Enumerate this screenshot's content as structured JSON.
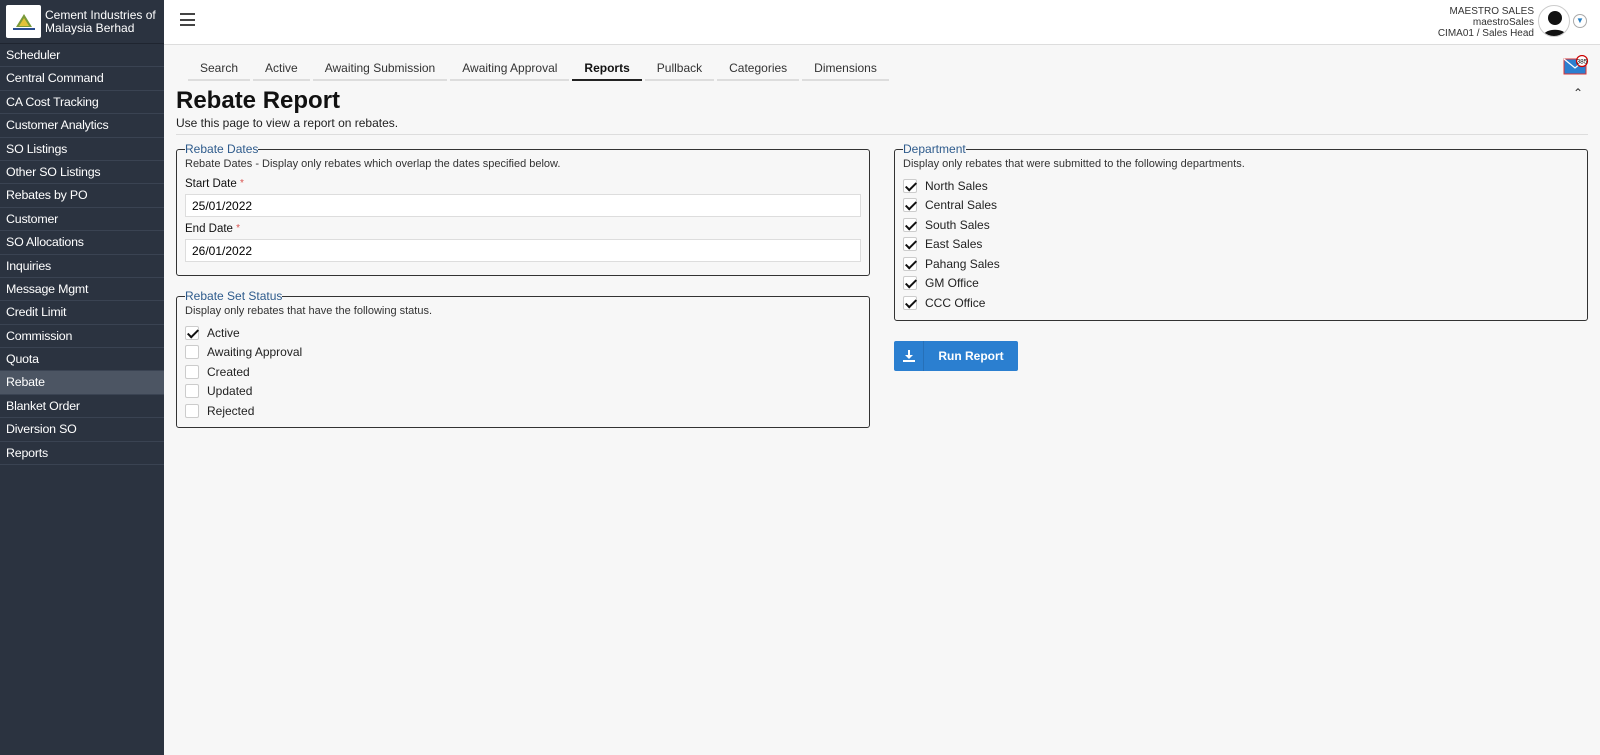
{
  "brand": {
    "name": "Cement Industries of Malaysia Berhad"
  },
  "sidebar": {
    "items": [
      {
        "label": "Scheduler"
      },
      {
        "label": "Central Command"
      },
      {
        "label": "CA Cost Tracking"
      },
      {
        "label": "Customer Analytics"
      },
      {
        "label": "SO Listings"
      },
      {
        "label": "Other SO Listings"
      },
      {
        "label": "Rebates by PO"
      },
      {
        "label": "Customer"
      },
      {
        "label": "SO Allocations"
      },
      {
        "label": "Inquiries"
      },
      {
        "label": "Message Mgmt"
      },
      {
        "label": "Credit Limit"
      },
      {
        "label": "Commission"
      },
      {
        "label": "Quota"
      },
      {
        "label": "Rebate"
      },
      {
        "label": "Blanket Order"
      },
      {
        "label": "Diversion SO"
      },
      {
        "label": "Reports"
      }
    ],
    "active": "Rebate"
  },
  "header": {
    "user_name": "MAESTRO SALES",
    "user_login": "maestroSales",
    "user_role": "CIMA01 / Sales Head",
    "mail_count": "385"
  },
  "tabs": [
    {
      "label": "Search"
    },
    {
      "label": "Active"
    },
    {
      "label": "Awaiting Submission"
    },
    {
      "label": "Awaiting Approval"
    },
    {
      "label": "Reports"
    },
    {
      "label": "Pullback"
    },
    {
      "label": "Categories"
    },
    {
      "label": "Dimensions"
    }
  ],
  "page": {
    "title": "Rebate Report",
    "subtitle": "Use this page to view a report on rebates."
  },
  "rebate_dates": {
    "legend": "Rebate Dates",
    "description": "Rebate Dates - Display only rebates which overlap the dates specified below.",
    "start_label": "Start Date",
    "start_value": "25/01/2022",
    "end_label": "End Date",
    "end_value": "26/01/2022",
    "required_mark": "*"
  },
  "status": {
    "legend": "Rebate Set Status",
    "description": "Display only rebates that have the following status.",
    "options": [
      {
        "label": "Active",
        "checked": true
      },
      {
        "label": "Awaiting Approval",
        "checked": false
      },
      {
        "label": "Created",
        "checked": false
      },
      {
        "label": "Updated",
        "checked": false
      },
      {
        "label": "Rejected",
        "checked": false
      }
    ]
  },
  "department": {
    "legend": "Department",
    "description": "Display only rebates that were submitted to the following departments.",
    "options": [
      {
        "label": "North Sales",
        "checked": true
      },
      {
        "label": "Central Sales",
        "checked": true
      },
      {
        "label": "South Sales",
        "checked": true
      },
      {
        "label": "East Sales",
        "checked": true
      },
      {
        "label": "Pahang Sales",
        "checked": true
      },
      {
        "label": "GM Office",
        "checked": true
      },
      {
        "label": "CCC Office",
        "checked": true
      }
    ]
  },
  "run_button": {
    "label": "Run Report"
  },
  "colors": {
    "sidebar_bg": "#2b3340",
    "accent": "#2b7fd0",
    "legend": "#2e5b8c"
  }
}
